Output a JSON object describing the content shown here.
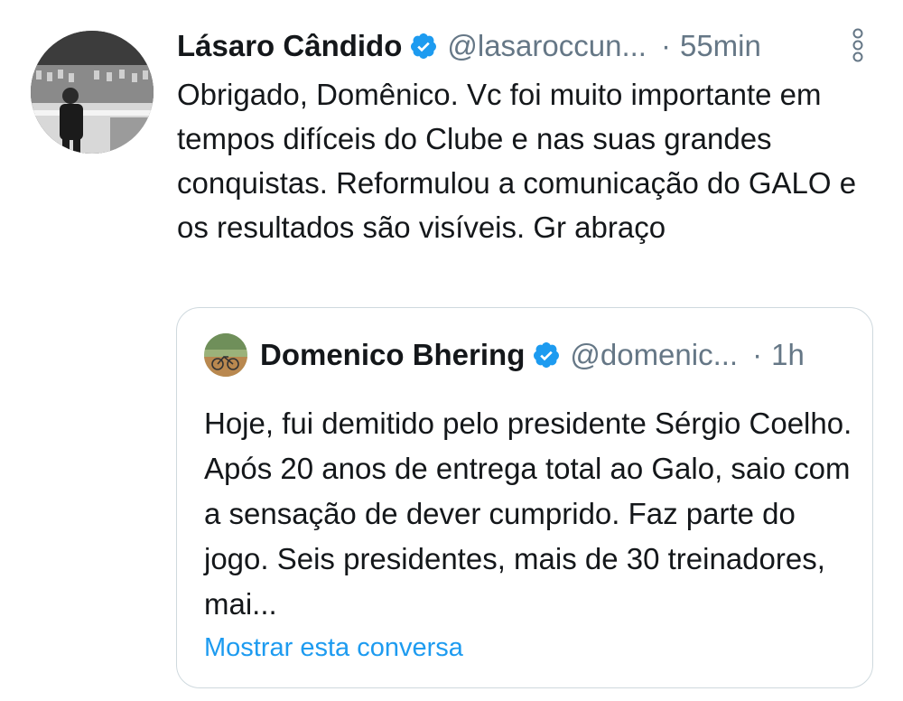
{
  "tweet": {
    "author_name": "Lásaro Cândido",
    "author_handle": "@lasaroccun...",
    "separator": "·",
    "time": "55min",
    "text": "Obrigado, Domênico. Vc foi muito importante em tempos difíceis do Clube e nas suas grandes conquistas. Reformulou a comunicação do GALO e os resultados são visíveis. Gr abraço"
  },
  "quoted_tweet": {
    "author_name": "Domenico Bhering",
    "author_handle": "@domenic...",
    "separator": "·",
    "time": "1h",
    "text": "Hoje, fui demitido pelo presidente Sérgio Coelho. Após 20 anos de entrega total ao Galo, saio com a sensação de dever cumprido. Faz parte do jogo. Seis presidentes, mais de 30 treinadores, mai...",
    "show_thread_link": "Mostrar esta conversa"
  },
  "icons": {
    "verified": "verified-badge-icon",
    "more": "more-options-icon"
  },
  "colors": {
    "accent": "#1d9bf0",
    "secondary_text": "#657786",
    "border": "#cfd9de"
  }
}
